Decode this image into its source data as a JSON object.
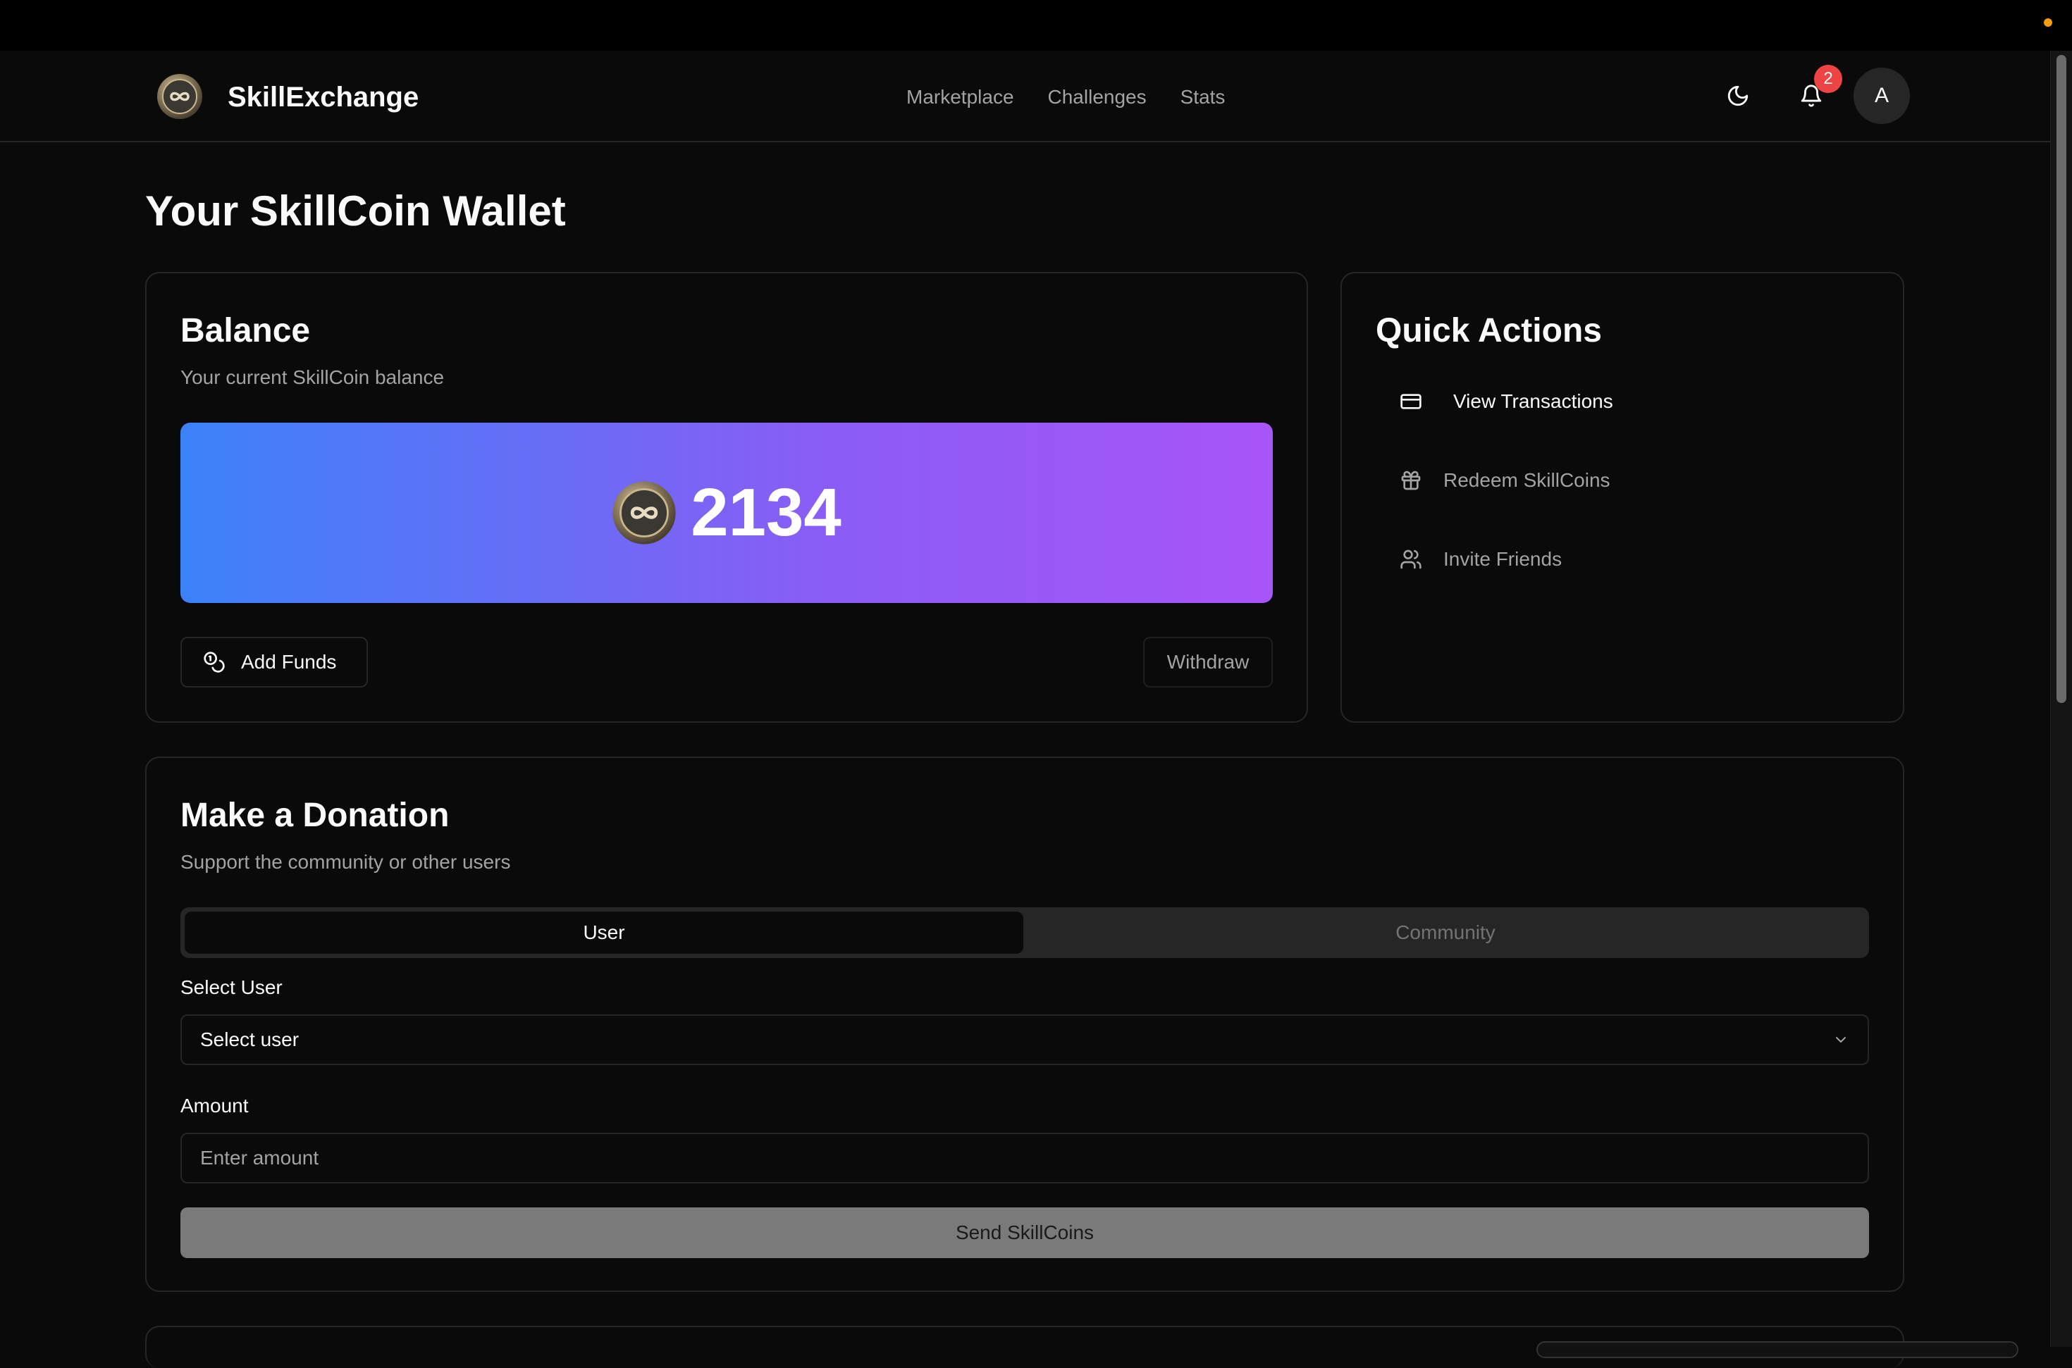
{
  "app": {
    "name": "SkillExchange"
  },
  "nav": {
    "items": [
      "Marketplace",
      "Challenges",
      "Stats"
    ]
  },
  "header": {
    "notification_count": "2",
    "avatar_initial": "A"
  },
  "page": {
    "title": "Your SkillCoin Wallet"
  },
  "balance": {
    "title": "Balance",
    "description": "Your current SkillCoin balance",
    "value": "2134",
    "add_funds_label": "Add Funds",
    "withdraw_label": "Withdraw"
  },
  "quick_actions": {
    "title": "Quick Actions",
    "items": [
      {
        "label": "View Transactions",
        "icon": "credit-card-icon"
      },
      {
        "label": "Redeem SkillCoins",
        "icon": "gift-icon"
      },
      {
        "label": "Invite Friends",
        "icon": "users-icon"
      }
    ]
  },
  "donation": {
    "title": "Make a Donation",
    "description": "Support the community or other users",
    "tabs": [
      {
        "label": "User",
        "active": true
      },
      {
        "label": "Community",
        "active": false
      }
    ],
    "select_user_label": "Select User",
    "select_user_value": "Select user",
    "amount_label": "Amount",
    "amount_placeholder": "Enter amount",
    "send_label": "Send SkillCoins"
  },
  "colors": {
    "background": "#0a0a0a",
    "border": "#262626",
    "gradient_start": "#3b82f6",
    "gradient_end": "#a855f7",
    "badge": "#ef4444"
  }
}
